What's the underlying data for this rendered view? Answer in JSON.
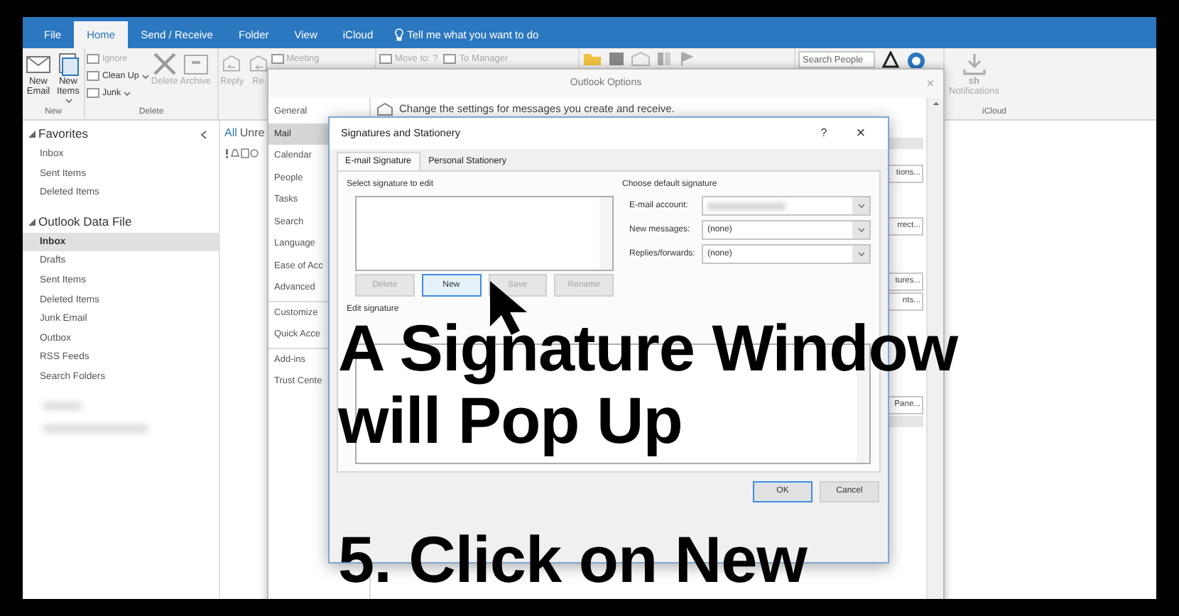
{
  "ribbon_tabs": [
    {
      "label": "File",
      "selected": false
    },
    {
      "label": "Home",
      "selected": true
    },
    {
      "label": "Send / Receive",
      "selected": false
    },
    {
      "label": "Folder",
      "selected": false
    },
    {
      "label": "View",
      "selected": false
    },
    {
      "label": "iCloud",
      "selected": false
    }
  ],
  "tell_me": "Tell me what you want to do",
  "ribbon_groups": [
    {
      "label": "New",
      "items": [
        {
          "kind": "large",
          "label": "New Email",
          "disabled": false,
          "dropdown": false
        },
        {
          "kind": "large",
          "label": "New Items",
          "disabled": false,
          "dropdown": true
        }
      ]
    },
    {
      "label": "Delete",
      "items": [
        {
          "kind": "stack",
          "entries": [
            {
              "label": "Ignore",
              "disabled": true,
              "dropdown": false
            },
            {
              "label": "Clean Up",
              "disabled": false,
              "dropdown": true
            },
            {
              "label": "Junk",
              "disabled": false,
              "dropdown": true
            }
          ]
        },
        {
          "kind": "large",
          "label": "Delete",
          "disabled": true,
          "dropdown": false
        },
        {
          "kind": "large",
          "label": "Archive",
          "disabled": true,
          "dropdown": false
        }
      ]
    },
    {
      "items": [
        {
          "kind": "large",
          "label": "Reply",
          "disabled": true,
          "dropdown": false
        },
        {
          "kind": "large",
          "label": "Re",
          "disabled": true,
          "dropdown": false
        },
        {
          "kind": "stack",
          "entries": [
            {
              "label": "Meeting",
              "disabled": true,
              "dropdown": false
            }
          ]
        }
      ]
    },
    {
      "items": [
        {
          "kind": "stack",
          "entries": [
            {
              "label": "Move to: ?",
              "disabled": true,
              "dropdown": false
            }
          ]
        },
        {
          "kind": "stack",
          "entries": [
            {
              "label": "To Manager",
              "disabled": true,
              "dropdown": false
            }
          ]
        }
      ]
    },
    {
      "items": [
        {
          "kind": "icon_row"
        }
      ]
    },
    {
      "items": [
        {
          "kind": "search",
          "placeholder": "Search People"
        },
        {
          "kind": "app_icons"
        }
      ]
    },
    {
      "label": "iCloud",
      "items": [
        {
          "kind": "large",
          "label": "**sh** Notifications",
          "disabled": true,
          "dropdown": false
        }
      ]
    }
  ],
  "folder_pane": {
    "sections": [
      {
        "label": "Favorites",
        "expanded": true,
        "children": [
          {
            "label": "Inbox",
            "selected": false
          },
          {
            "label": "Sent Items",
            "selected": false
          },
          {
            "label": "Deleted Items",
            "selected": false
          }
        ]
      },
      {
        "label": "Outlook Data File",
        "expanded": true,
        "children": [
          {
            "label": "Inbox",
            "selected": true
          },
          {
            "label": "Drafts",
            "selected": false
          },
          {
            "label": "Sent Items",
            "selected": false
          },
          {
            "label": "Deleted Items",
            "selected": false
          },
          {
            "label": "Junk Email",
            "selected": false
          },
          {
            "label": "Outbox",
            "selected": false
          },
          {
            "label": "RSS Feeds",
            "selected": false
          },
          {
            "label": "Search Folders",
            "selected": false
          }
        ]
      }
    ]
  },
  "message_list": {
    "filters": [
      {
        "label": "All",
        "selected": true
      },
      {
        "label": "Unre",
        "selected": false
      }
    ]
  },
  "options_dialog": {
    "title": "Outlook Options",
    "close": "×",
    "nav": [
      {
        "label": "General",
        "selected": false,
        "separator_before": false
      },
      {
        "label": "Mail",
        "selected": true,
        "separator_before": false
      },
      {
        "label": "Calendar",
        "selected": false,
        "separator_before": false
      },
      {
        "label": "People",
        "selected": false,
        "separator_before": false
      },
      {
        "label": "Tasks",
        "selected": false,
        "separator_before": false
      },
      {
        "label": "Search",
        "selected": false,
        "separator_before": false
      },
      {
        "label": "Language",
        "selected": false,
        "separator_before": false
      },
      {
        "label": "Ease of Acc",
        "selected": false,
        "separator_before": false
      },
      {
        "label": "Advanced",
        "selected": false,
        "separator_before": false
      },
      {
        "label": "Customize",
        "selected": false,
        "separator_before": true
      },
      {
        "label": "Quick Acce",
        "selected": false,
        "separator_before": false
      },
      {
        "label": "Add-ins",
        "selected": false,
        "separator_before": true
      },
      {
        "label": "Trust Cente",
        "selected": false,
        "separator_before": false
      }
    ],
    "header": "Change the settings for messages you create and receive.",
    "side_buttons": [
      "tions...",
      "rrect...",
      "tures...",
      "nts...",
      "Pane..."
    ]
  },
  "signature_dialog": {
    "title": "Signatures and Stationery",
    "help": "?",
    "close": "×",
    "tabs": [
      {
        "label": "E-mail Signature",
        "selected": true
      },
      {
        "label": "Personal Stationery",
        "selected": false
      }
    ],
    "select_label": "Select signature to edit",
    "buttons": [
      {
        "label": "Delete",
        "disabled": true,
        "focused": false
      },
      {
        "label": "New",
        "disabled": false,
        "focused": true
      },
      {
        "label": "Save",
        "disabled": true,
        "focused": false
      },
      {
        "label": "Rename",
        "disabled": true,
        "focused": false
      }
    ],
    "default_label": "Choose default signature",
    "fields": [
      {
        "kind": "redacted",
        "label": "E-mail account:"
      },
      {
        "kind": "select",
        "label": "New messages:",
        "value": "(none)"
      },
      {
        "kind": "select",
        "label": "Replies/forwards:",
        "value": "(none)"
      }
    ],
    "edit_label": "Edit signature",
    "footer_buttons": [
      {
        "label": "OK",
        "default": true
      },
      {
        "label": "Cancel",
        "default": false
      }
    ]
  },
  "caption": {
    "headline_lines": [
      "A Signature Window",
      "will Pop Up"
    ],
    "step": "5. Click on New"
  }
}
